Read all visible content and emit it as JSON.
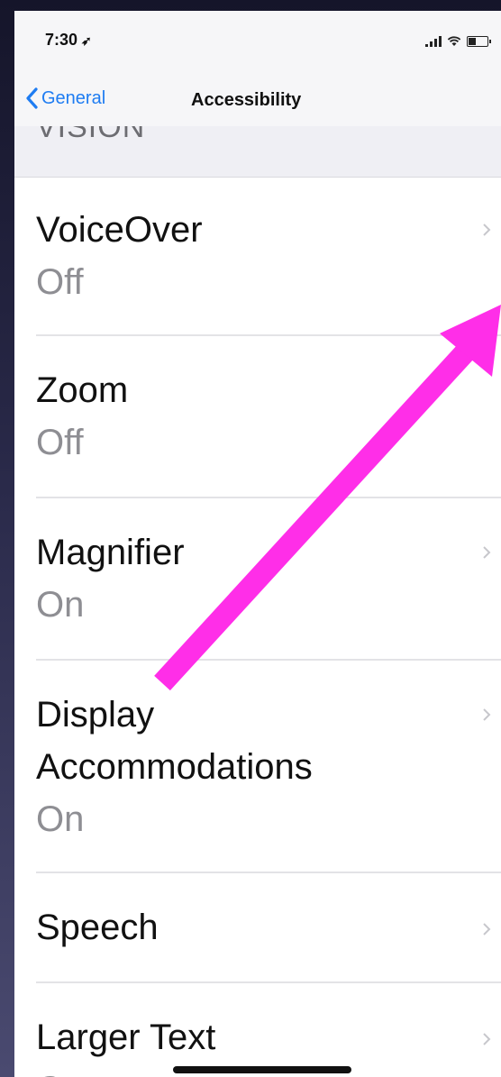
{
  "status_bar": {
    "time": "7:30",
    "location_icon": "location-arrow-icon"
  },
  "nav": {
    "back_label": "General",
    "title": "Accessibility"
  },
  "section": {
    "header": "VISION"
  },
  "items": [
    {
      "title": "VoiceOver",
      "value": "Off"
    },
    {
      "title": "Zoom",
      "value": "Off"
    },
    {
      "title": "Magnifier",
      "value": "On"
    },
    {
      "title": "Display",
      "title2": "Accommodations",
      "value": "On"
    },
    {
      "title": "Speech",
      "value": ""
    },
    {
      "title": "Larger Text",
      "value": "On"
    }
  ],
  "colors": {
    "accent": "#1e7cf2",
    "annotation_arrow": "#ff2ee8"
  }
}
